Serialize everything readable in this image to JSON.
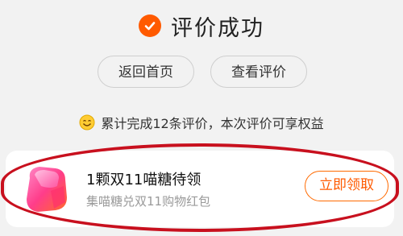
{
  "header": {
    "title": "评价成功",
    "check_icon": "check-circle-icon",
    "accent_color": "#ff5a00"
  },
  "actions": {
    "home_label": "返回首页",
    "view_review_label": "查看评价"
  },
  "stats": {
    "icon": "smile-face-icon",
    "text": "累计完成12条评价，本次评价可享权益"
  },
  "reward_card": {
    "icon": "candy-gift-icon",
    "title": "1颗双11喵糖待领",
    "subtitle": "集喵糖兑双11购物红包",
    "claim_label": "立即领取",
    "highlight_color": "#c8101e"
  }
}
